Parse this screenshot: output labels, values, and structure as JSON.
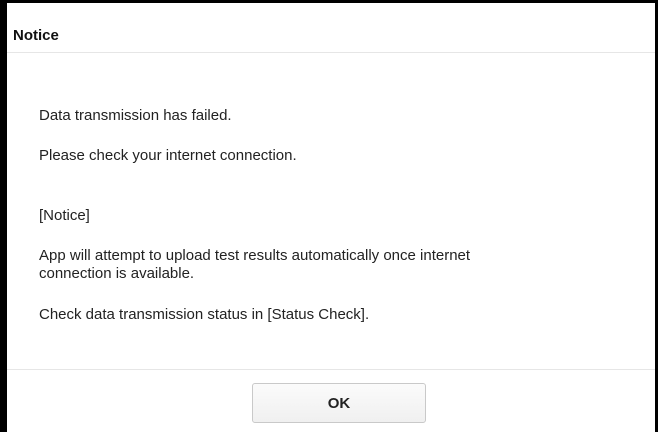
{
  "dialog": {
    "title": "Notice",
    "message_lines": [
      "Data transmission has failed.",
      "Please check your internet connection.",
      "[Notice]",
      "App will attempt to upload test results automatically once internet",
      "connection is available.",
      "Check data transmission status in [Status Check]."
    ],
    "ok_label": "OK"
  }
}
